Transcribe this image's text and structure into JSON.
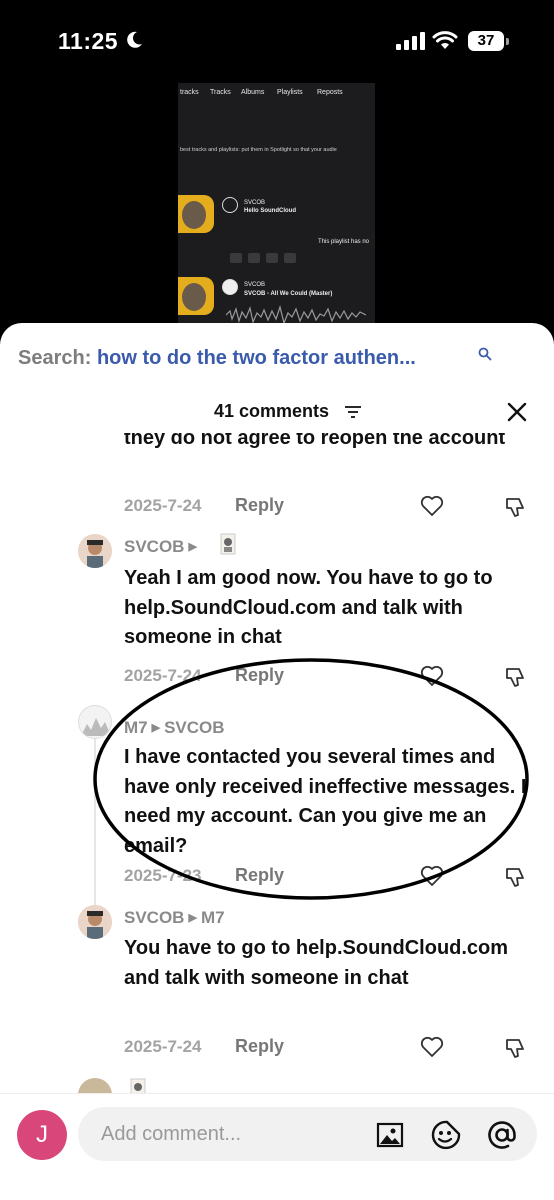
{
  "status_bar": {
    "time": "11:25",
    "battery": "37"
  },
  "video": {
    "tabs": [
      "tracks",
      "Tracks",
      "Albums",
      "Playlists",
      "Reposts"
    ],
    "spotlight_text": "best tracks and playlists: put them in Spotlight so that your audie",
    "track1": {
      "user": "SVCOB",
      "title": "Hello SoundCloud"
    },
    "playlist_note": "This playlist has no",
    "track2": {
      "user": "SVCOB",
      "title": "SVCOB - All We Could (Master)"
    }
  },
  "search": {
    "prefix": "Search:",
    "query": "how to do the two factor authen..."
  },
  "comments_header": {
    "count_label": "41 comments"
  },
  "comments": [
    {
      "text": "they do not agree to reopen the account",
      "date": "2025-7-24",
      "reply": "Reply"
    },
    {
      "user": "SVCOB",
      "reply_to": "",
      "text": "Yeah I am good now. You have to go to help.SoundCloud.com and talk with someone in chat",
      "date": "2025-7-24",
      "reply": "Reply"
    },
    {
      "user": "M7",
      "reply_to": "SVCOB",
      "text": "I have contacted you several times and have only received ineffective messages. I need my account. Can you give me an email?",
      "date": "2025-7-23",
      "reply": "Reply"
    },
    {
      "user": "SVCOB",
      "reply_to": "M7",
      "text": "You have to go to help.SoundCloud.com and talk with someone in chat",
      "date": "2025-7-24",
      "reply": "Reply"
    }
  ],
  "composer": {
    "avatar_letter": "J",
    "placeholder": "Add comment..."
  },
  "colors": {
    "search_query": "#3a5bab",
    "avatar_bg": "#d9467a",
    "accent_gold": "#e4ad1e"
  }
}
